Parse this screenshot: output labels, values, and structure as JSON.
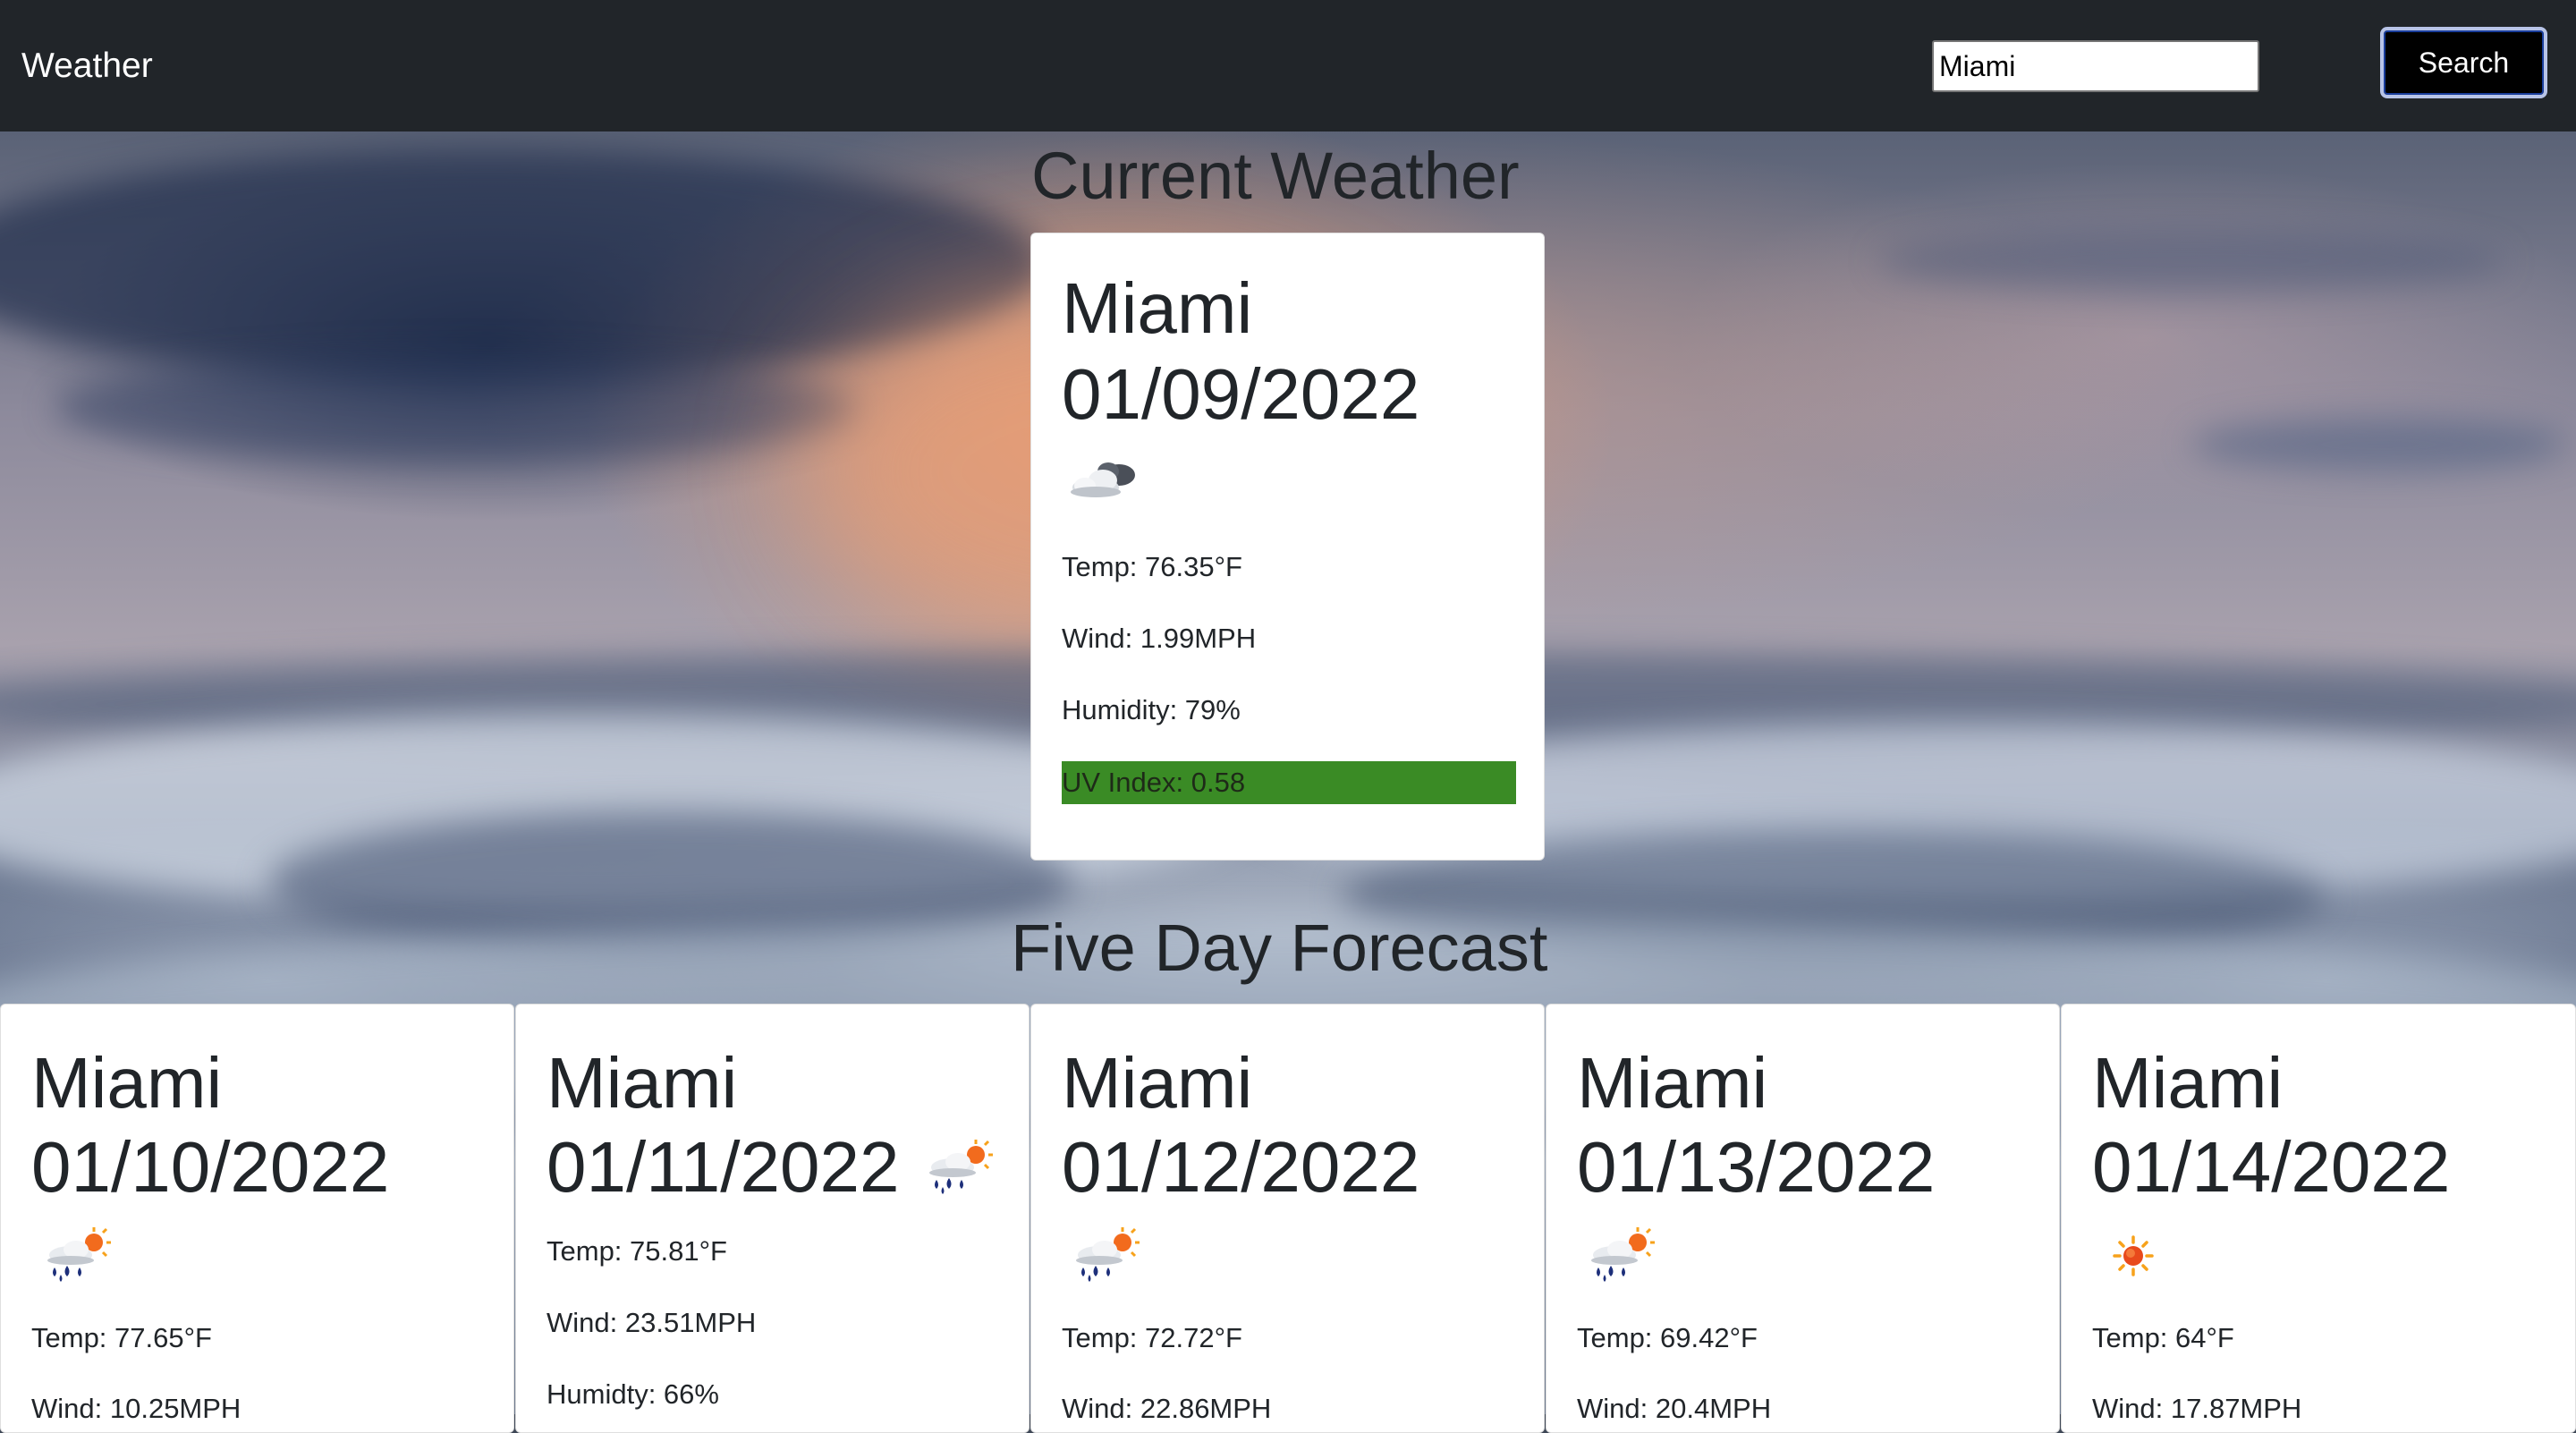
{
  "navbar": {
    "brand": "Weather",
    "search_value": "Miami",
    "search_button": "Search"
  },
  "current": {
    "heading": "Current Weather",
    "city": "Miami",
    "date": "01/09/2022",
    "icon": "partly-cloudy-icon",
    "temp": "Temp: 76.35°F",
    "wind": "Wind: 1.99MPH",
    "humidity": "Humidity: 79%",
    "uv": "UV Index: 0.58",
    "uv_color": "#3a8b25"
  },
  "forecast": {
    "heading": "Five Day Forecast",
    "days": [
      {
        "city": "Miami",
        "date": "01/10/2022",
        "icon": "rain-sun-icon",
        "temp": "Temp: 77.65°F",
        "wind": "Wind: 10.25MPH"
      },
      {
        "city": "Miami",
        "date": "01/11/2022",
        "icon": "rain-sun-icon",
        "temp": "Temp: 75.81°F",
        "wind": "Wind: 23.51MPH",
        "humidity": "Humidty: 66%"
      },
      {
        "city": "Miami",
        "date": "01/12/2022",
        "icon": "rain-sun-icon",
        "temp": "Temp: 72.72°F",
        "wind": "Wind: 22.86MPH"
      },
      {
        "city": "Miami",
        "date": "01/13/2022",
        "icon": "rain-sun-icon",
        "temp": "Temp: 69.42°F",
        "wind": "Wind: 20.4MPH"
      },
      {
        "city": "Miami",
        "date": "01/14/2022",
        "icon": "sun-icon",
        "temp": "Temp: 64°F",
        "wind": "Wind: 17.87MPH"
      }
    ]
  }
}
